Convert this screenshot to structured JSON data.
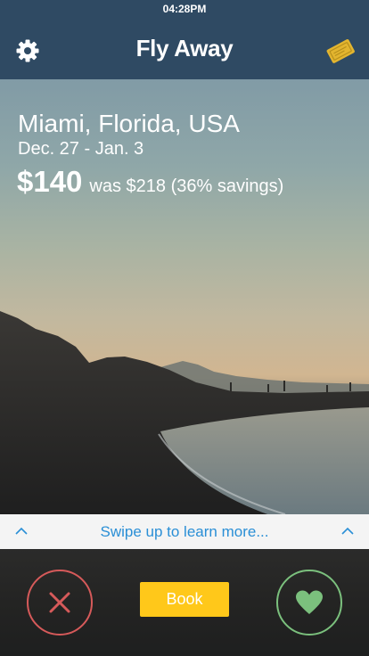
{
  "status_bar": {
    "time": "04:28PM"
  },
  "header": {
    "title": "Fly Away",
    "left_icon": "gear-icon",
    "right_icon": "ticket-icon"
  },
  "deal": {
    "destination": "Miami, Florida, USA",
    "dates": "Dec. 27 - Jan. 3",
    "price": "$140",
    "was_text": "was $218 (36% savings)"
  },
  "swipe_hint": {
    "text": "Swipe up to learn more..."
  },
  "actions": {
    "reject_icon": "close-icon",
    "book_label": "Book",
    "like_icon": "heart-icon"
  },
  "colors": {
    "header_bg": "#2f4a63",
    "accent_blue": "#2a8fd6",
    "book_yellow": "#ffc81a",
    "reject_red": "#d65a5a",
    "like_green": "#7bc07d"
  }
}
